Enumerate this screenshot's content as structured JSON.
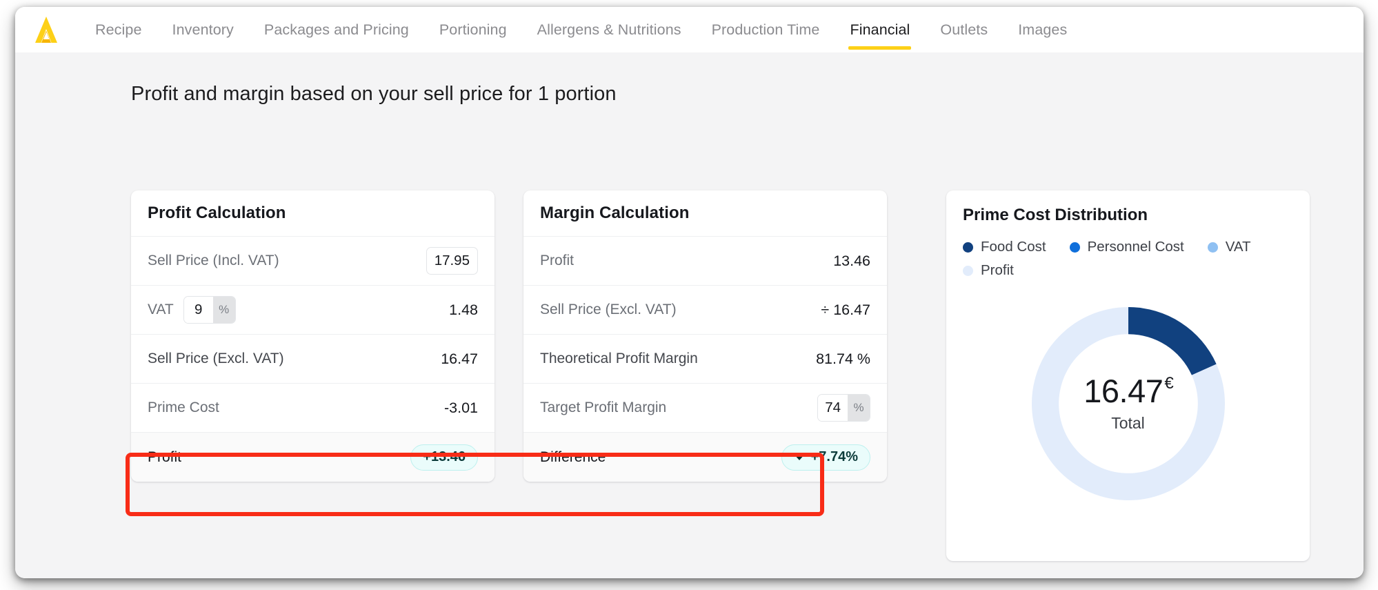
{
  "nav": {
    "logo_icon": "app-logo-icon",
    "logo_color": "#fdd017",
    "tabs": [
      {
        "label": "Recipe",
        "active": false
      },
      {
        "label": "Inventory",
        "active": false
      },
      {
        "label": "Packages and Pricing",
        "active": false
      },
      {
        "label": "Portioning",
        "active": false
      },
      {
        "label": "Allergens & Nutritions",
        "active": false
      },
      {
        "label": "Production Time",
        "active": false
      },
      {
        "label": "Financial",
        "active": true
      },
      {
        "label": "Outlets",
        "active": false
      },
      {
        "label": "Images",
        "active": false
      }
    ],
    "active_underline_color": "#fdd017"
  },
  "page": {
    "title": "Profit and margin based on your sell price for 1 portion",
    "background": "#f4f4f5"
  },
  "profit_card": {
    "title": "Profit Calculation",
    "rows": [
      {
        "label": "Sell Price (Incl. VAT)",
        "value": "17.95",
        "kind": "input"
      },
      {
        "label": "VAT",
        "input_value": "9",
        "input_suffix": "%",
        "value": "1.48",
        "kind": "pct-input"
      },
      {
        "label": "Sell Price (Excl. VAT)",
        "value": "16.47",
        "kind": "text"
      },
      {
        "label": "Prime Cost",
        "value": "-3.01",
        "kind": "text"
      }
    ],
    "summary": {
      "label": "Profit",
      "badge": "+13.46",
      "badge_color": "#eafcfb"
    }
  },
  "margin_card": {
    "title": "Margin Calculation",
    "rows": [
      {
        "label": "Profit",
        "value": "13.46",
        "kind": "text"
      },
      {
        "label": "Sell Price (Excl. VAT)",
        "value": "÷ 16.47",
        "kind": "text"
      },
      {
        "label": "Theoretical Profit Margin",
        "value": "81.74 %",
        "kind": "text"
      },
      {
        "label": "Target Profit Margin",
        "input_value": "74",
        "input_suffix": "%",
        "kind": "pct-input-only"
      }
    ],
    "summary": {
      "label": "Difference",
      "badge": "+7.74%",
      "badge_icon": "triangle-down-icon",
      "badge_color": "#eafcfb"
    }
  },
  "chart_card": {
    "title": "Prime Cost Distribution",
    "center_amount": "16.47",
    "center_currency": "€",
    "center_label": "Total"
  },
  "chart_data": {
    "type": "pie",
    "title": "Prime Cost Distribution",
    "subtype": "donut",
    "center_value": 16.47,
    "center_currency": "€",
    "center_label": "Total",
    "legend_position": "top",
    "labels": [
      "Food Cost",
      "Personnel Cost",
      "VAT",
      "Profit"
    ],
    "values": [
      3.01,
      0,
      0,
      13.46
    ],
    "percentages": [
      18.27,
      0,
      0,
      81.73
    ],
    "colors": [
      "#11417f",
      "#0f6fdb",
      "#8fc0f2",
      "#e2ecfb"
    ],
    "start_angle_deg": 0,
    "inner_radius_ratio": 0.72
  },
  "annotation": {
    "highlight_color": "#f82c17",
    "shape": "rectangle"
  }
}
